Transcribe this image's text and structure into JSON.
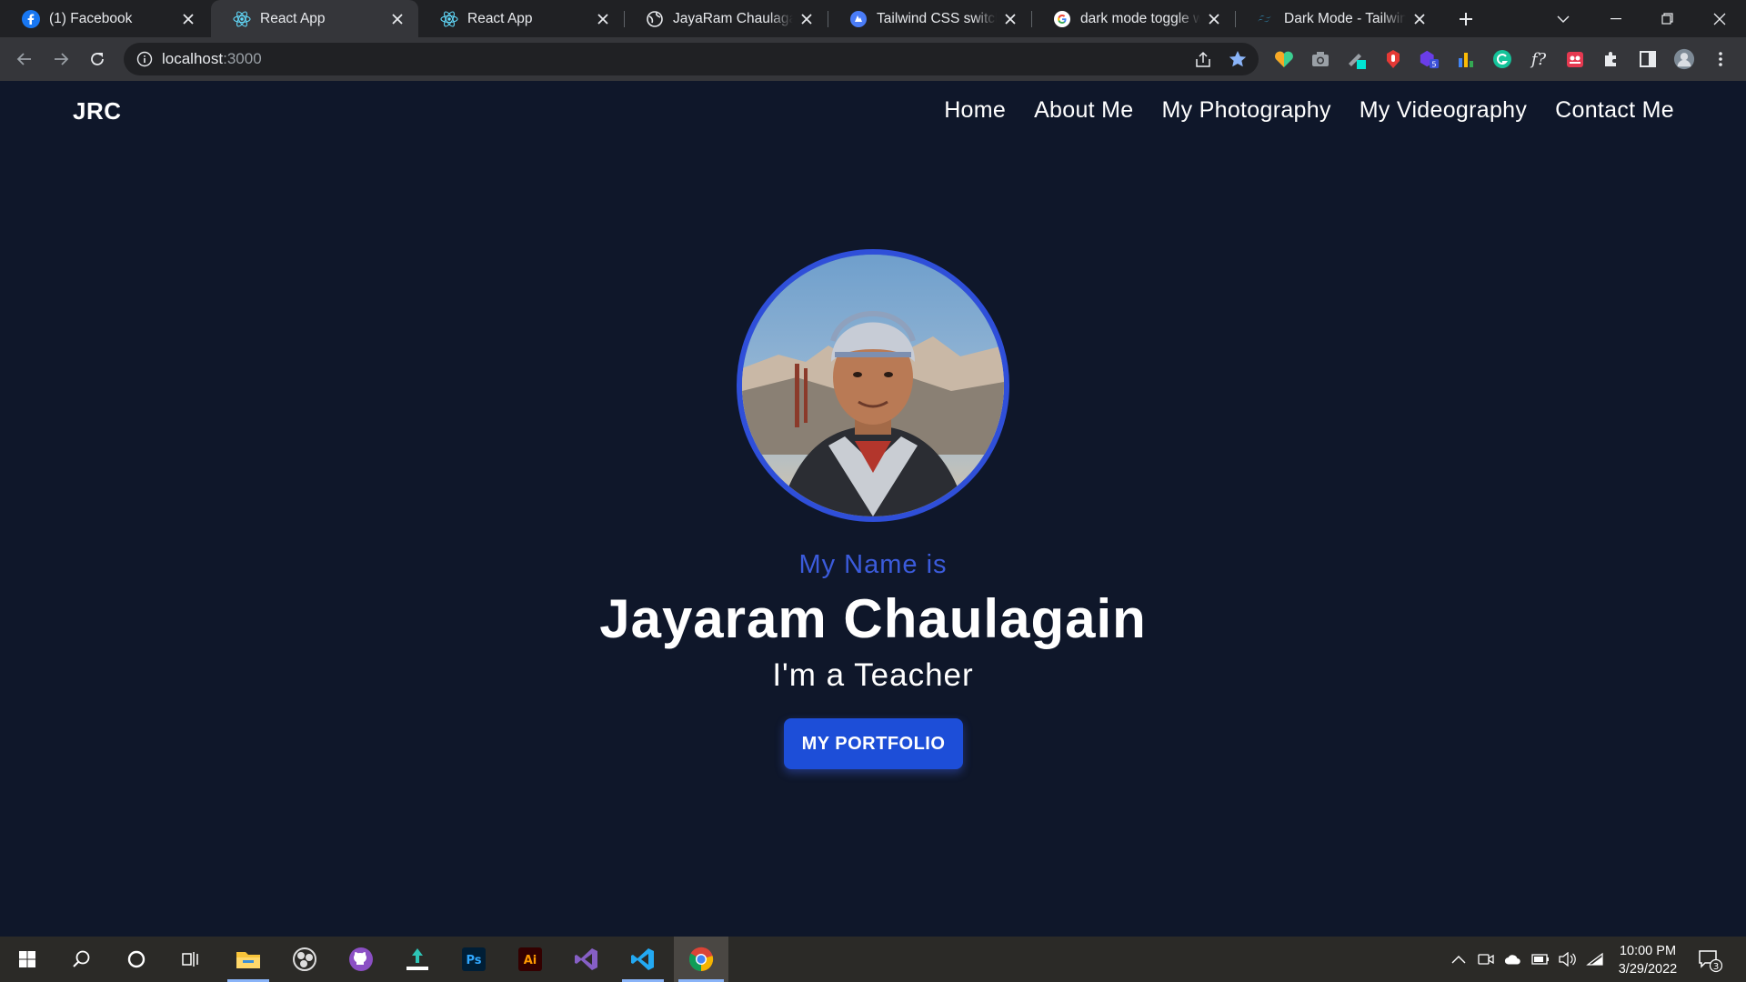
{
  "browser": {
    "tabs": [
      {
        "title": "(1) Facebook",
        "icon": "facebook-icon"
      },
      {
        "title": "React App",
        "icon": "react-icon",
        "active": true
      },
      {
        "title": "React App",
        "icon": "react-icon"
      },
      {
        "title": "JayaRam Chaulagain -",
        "icon": "globe-icon"
      },
      {
        "title": "Tailwind CSS switch /",
        "icon": "codepen-icon"
      },
      {
        "title": "dark mode toggle wit",
        "icon": "google-icon"
      },
      {
        "title": "Dark Mode - Tailwind",
        "icon": "tailwind-icon"
      }
    ],
    "url_host": "localhost",
    "url_port": ":3000"
  },
  "site": {
    "brand": "JRC",
    "nav": [
      "Home",
      "About Me",
      "My Photography",
      "My Videography",
      "Contact Me"
    ],
    "hero": {
      "subtitle": "My Name is",
      "name": "Jayaram Chaulagain",
      "role": "I'm a Teacher",
      "cta": "MY PORTFOLIO"
    }
  },
  "taskbar": {
    "time": "10:00 PM",
    "date": "3/29/2022",
    "notification_count": "3",
    "extension_badge": "5"
  },
  "colors": {
    "page_bg": "#0f172a",
    "accent": "#1d4ed8",
    "subtitle": "#3b5bdb"
  }
}
